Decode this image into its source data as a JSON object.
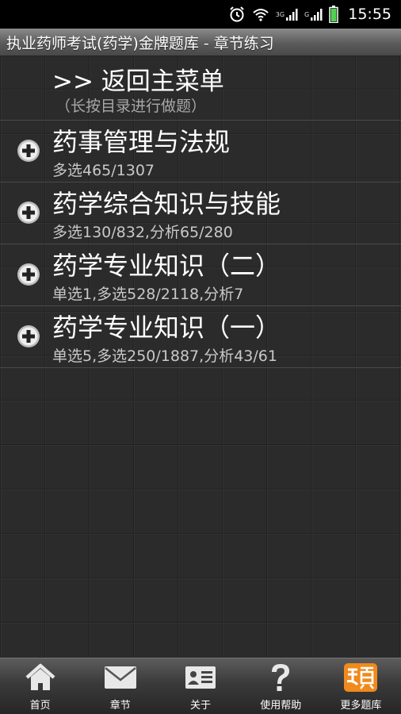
{
  "status_bar": {
    "time": "15:55",
    "network1": "3G",
    "network2": "G",
    "icons": [
      "alarm-icon",
      "wifi-icon",
      "signal-3g-icon",
      "signal-g-icon",
      "battery-icon"
    ]
  },
  "header": {
    "title": "执业药师考试(药学)金牌题库  -  章节练习"
  },
  "menu": {
    "back_label": ">> 返回主菜单",
    "hint": "（长按目录进行做题）"
  },
  "chapters": [
    {
      "name": "药事管理与法规",
      "stats": "多选465/1307",
      "icon": "expand-plus-icon"
    },
    {
      "name": "药学综合知识与技能",
      "stats": "多选130/832,分析65/280",
      "icon": "expand-plus-icon"
    },
    {
      "name": "药学专业知识（二）",
      "stats": "单选1,多选528/2118,分析7",
      "icon": "expand-plus-icon"
    },
    {
      "name": "药学专业知识（一）",
      "stats": "单选5,多选250/1887,分析43/61",
      "icon": "expand-plus-icon"
    }
  ],
  "bottom_nav": [
    {
      "label": "首页",
      "icon": "home-icon"
    },
    {
      "label": "章节",
      "icon": "envelope-icon"
    },
    {
      "label": "关于",
      "icon": "id-card-icon"
    },
    {
      "label": "使用帮助",
      "icon": "question-icon"
    },
    {
      "label": "更多题库",
      "icon": "ti-logo-icon"
    }
  ],
  "colors": {
    "background": "#2b2b2b",
    "title_bar": "#5b5b5b",
    "accent_orange": "#f08a1c"
  }
}
